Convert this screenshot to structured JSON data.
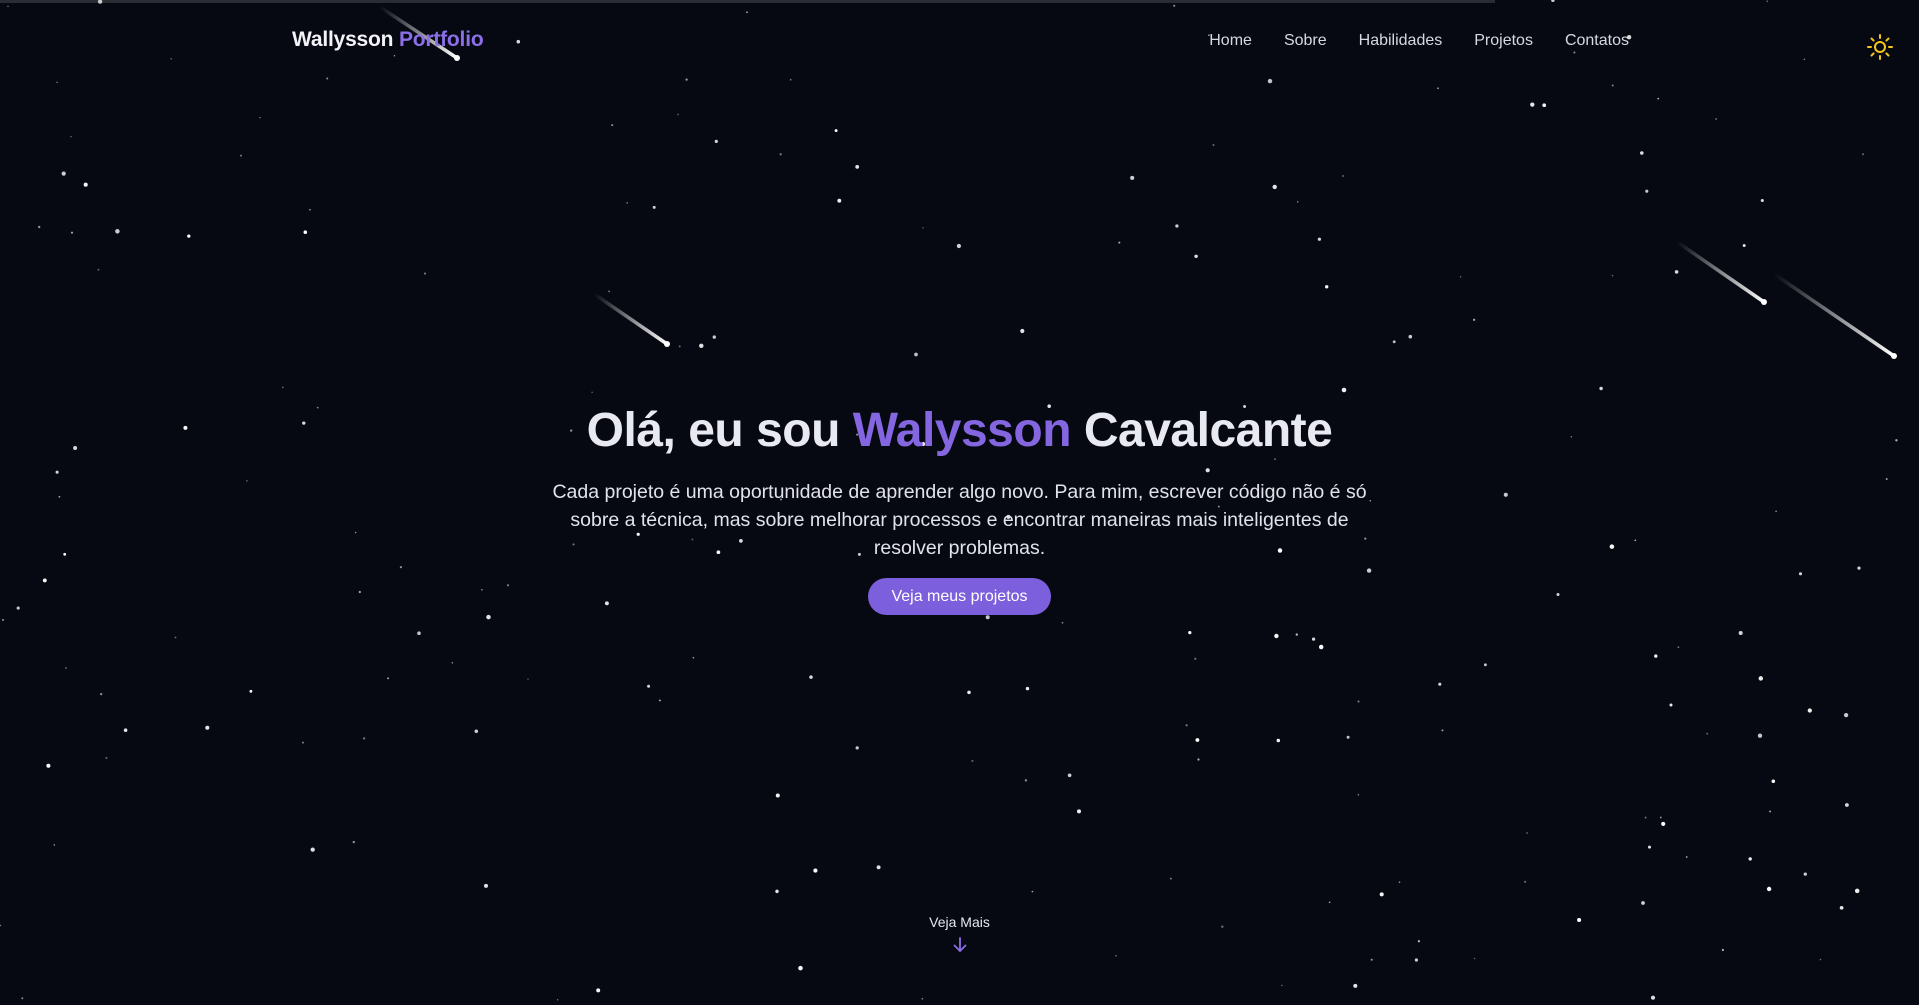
{
  "header": {
    "logo_name": "Wallysson",
    "logo_accent": "Portfolio",
    "nav": [
      "Home",
      "Sobre",
      "Habilidades",
      "Projetos",
      "Contatos"
    ],
    "theme_icon": "sun-icon"
  },
  "hero": {
    "greeting": "Olá, eu sou ",
    "first_name": "Walysson",
    "last_name": " Cavalcante",
    "description": "Cada projeto é uma oportunidade de aprender algo novo. Para mim, escrever código não é só sobre a técnica, mas sobre melhorar processos e encontrar maneiras mais inteligentes de resolver problemas.",
    "cta_label": "Veja meus projetos"
  },
  "footer": {
    "see_more_label": "Veja Mais",
    "see_more_icon": "arrow-down-icon"
  },
  "colors": {
    "background": "#070912",
    "accent": "#8466e0",
    "button": "#7c5fdc",
    "sun": "#f5c518"
  }
}
